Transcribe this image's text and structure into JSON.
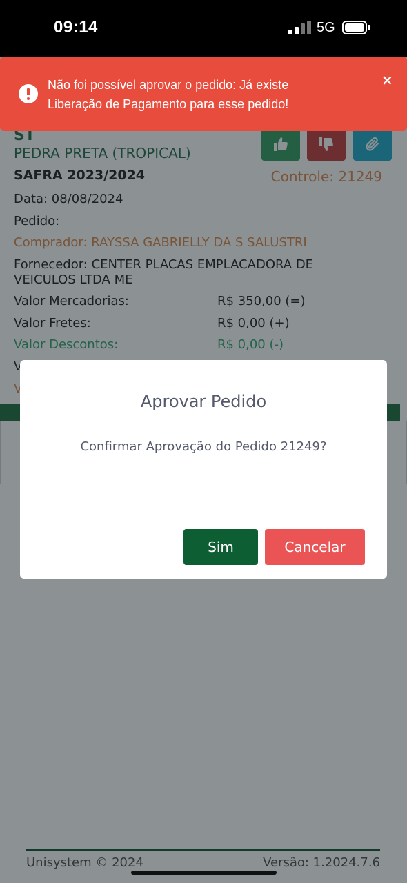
{
  "status_bar": {
    "time": "09:14",
    "network": "5G"
  },
  "order": {
    "header_cut": "ST",
    "farm": "PEDRA PRETA (TROPICAL)",
    "safra": "SAFRA 2023/2024",
    "controle": "Controle: 21249",
    "data": "Data: 08/08/2024",
    "pedido": "Pedido:",
    "comprador": "Comprador: RAYSSA GABRIELLY DA S SALUSTRI",
    "fornecedor_line1": "Fornecedor: CENTER PLACAS EMPLACADORA DE",
    "fornecedor_line2": "VEICULOS LTDA ME",
    "rows": [
      {
        "label": "Valor Mercadorias:",
        "value": "R$ 350,00 (=)"
      },
      {
        "label": "Valor Fretes:",
        "value": "R$ 0,00 (+)"
      },
      {
        "label": "Valor Descontos:",
        "value": "R$ 0,00 (-)"
      }
    ],
    "partial_v1": "V",
    "partial_v2": "V"
  },
  "actions": {
    "approve_icon": "thumbs-up-icon",
    "reject_icon": "thumbs-down-icon",
    "attach_icon": "paperclip-icon"
  },
  "colors": {
    "approve": "#2e9b5f",
    "reject": "#c0393d",
    "attach": "#1ba7c9",
    "toast": "#e84c3d",
    "primary": "#0e5e34",
    "danger": "#ea5455"
  },
  "toast": {
    "line1": "Não foi possível aprovar o pedido: Já existe",
    "line2": "Liberação de Pagamento para esse pedido!",
    "close": "×"
  },
  "modal": {
    "title": "Aprovar Pedido",
    "message": "Confirmar Aprovação do Pedido 21249?",
    "confirm_label": "Sim",
    "cancel_label": "Cancelar"
  },
  "footer": {
    "left": "Unisystem © 2024",
    "right": "Versão: 1.2024.7.6"
  }
}
